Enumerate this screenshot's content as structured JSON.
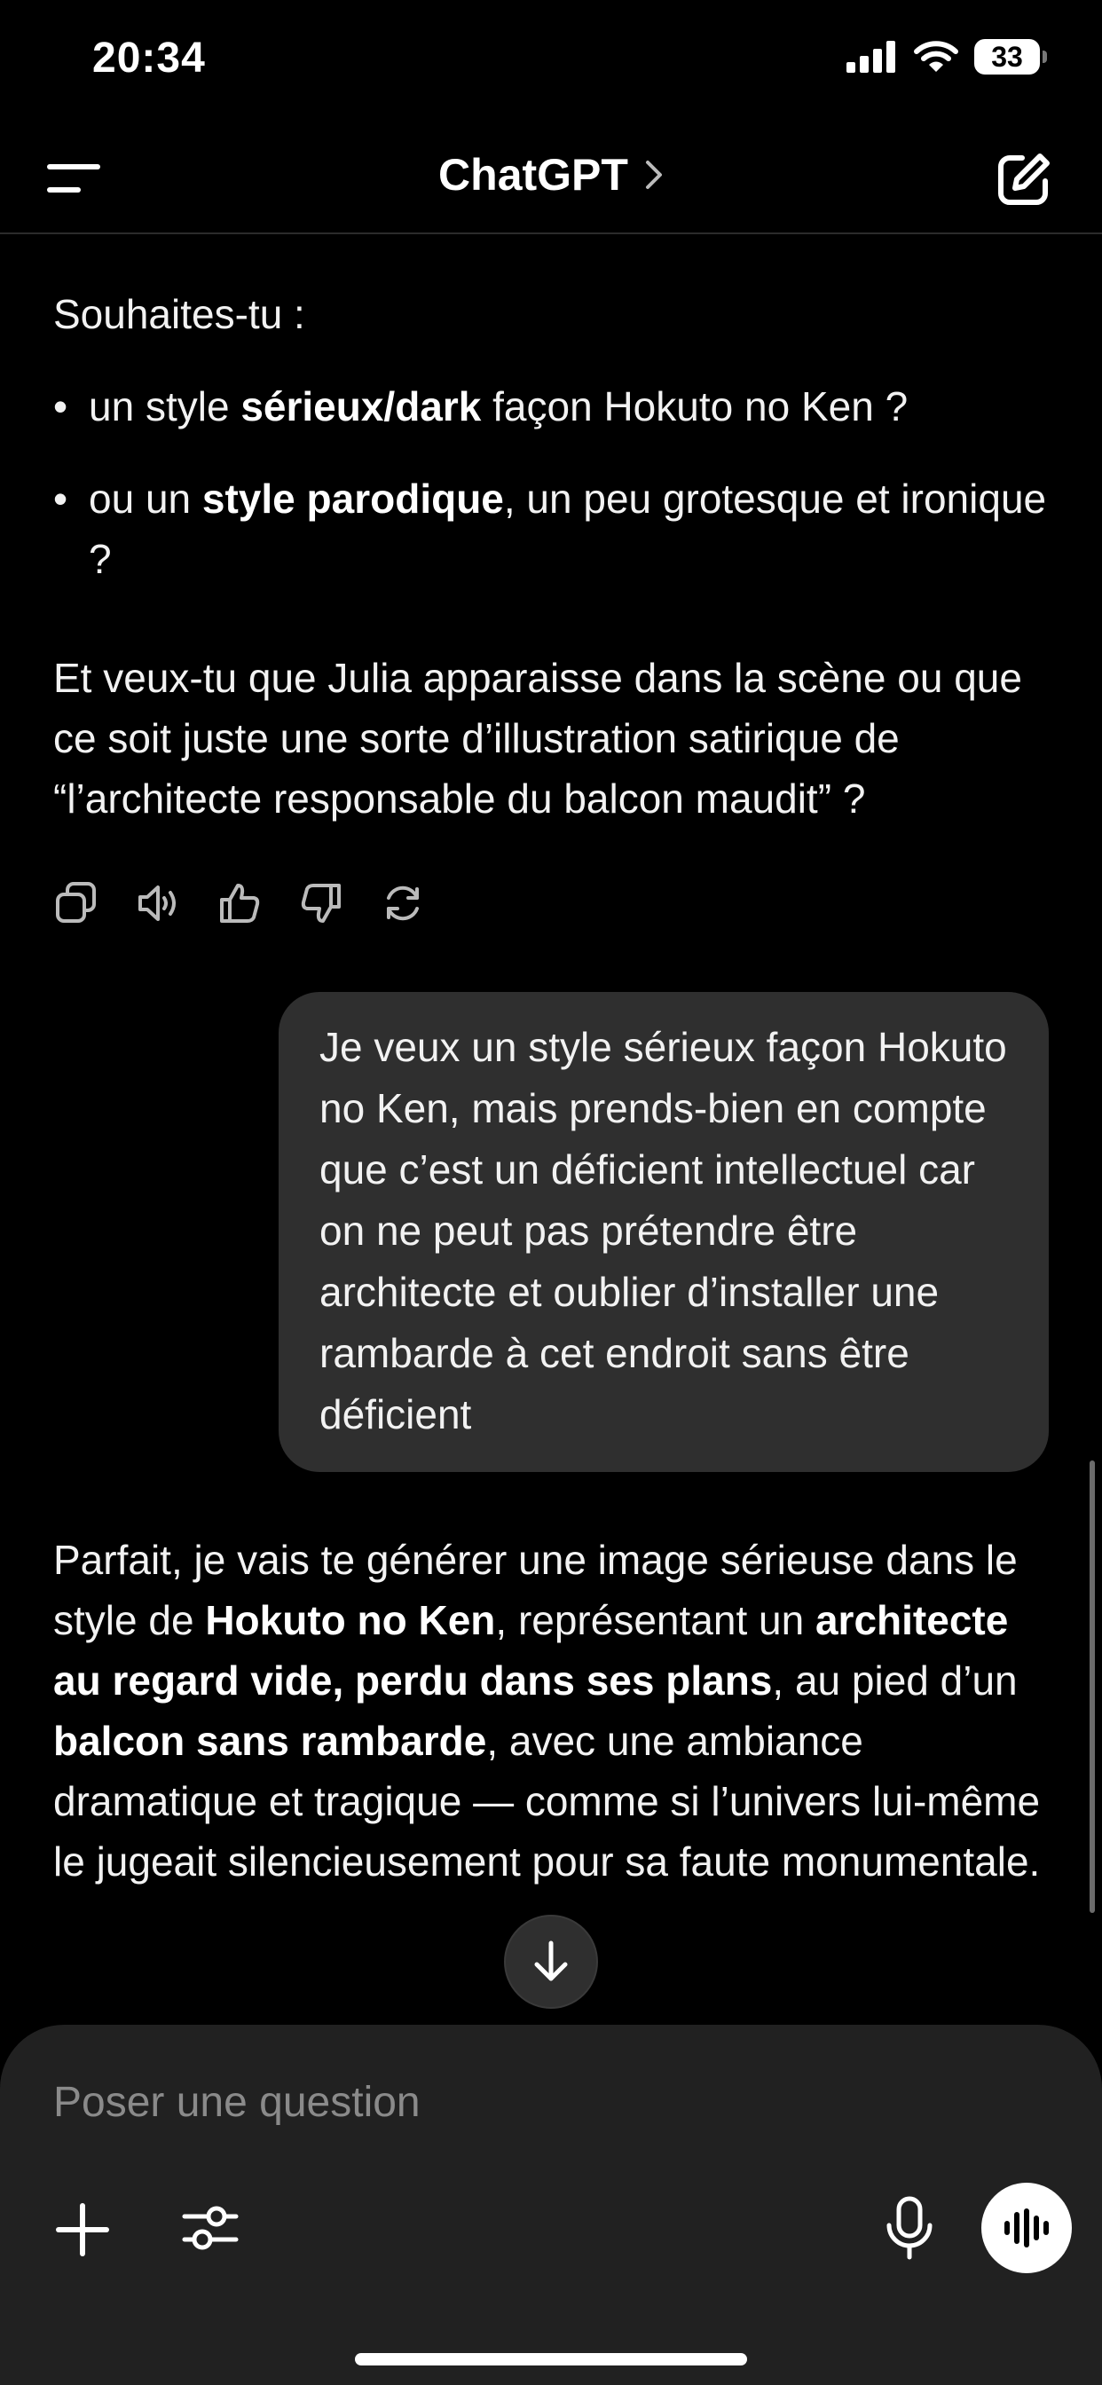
{
  "status_bar": {
    "time": "20:34",
    "battery": "33"
  },
  "header": {
    "title": "ChatGPT"
  },
  "messages": {
    "assistant_1": {
      "intro": "Souhaites-tu :",
      "bullets": [
        {
          "pre": "un style ",
          "bold": "sérieux/dark",
          "post": " façon Hokuto no Ken ?"
        },
        {
          "pre": "ou un ",
          "bold": "style parodique",
          "post": ", un peu grotesque et ironique ?"
        }
      ],
      "closing": "Et veux-tu que Julia apparaisse dans la scène ou que ce soit juste une sorte d’illustration satirique de “l’architecte responsable du balcon maudit” ?"
    },
    "user_1": {
      "text": "Je veux un style sérieux façon Hokuto no Ken, mais prends-bien en compte que c’est un déficient intellectuel car on ne peut pas prétendre être architecte et oublier d’installer une rambarde à cet endroit sans être déficient"
    },
    "assistant_2": {
      "s1": "Parfait, je vais te générer une image sérieuse dans le style de ",
      "b1": "Hokuto no Ken",
      "s2": ", représentant un ",
      "b2": "architecte au regard vide, perdu dans ses plans",
      "s3": ", au pied d’un ",
      "b3": "balcon sans rambarde",
      "s4": ", avec une ambiance dramatique et tragique — comme si l’univers lui-même le jugeait silencieusement pour sa faute monumentale."
    }
  },
  "actions": [
    "copy-icon",
    "speaker-icon",
    "thumbs-up-icon",
    "thumbs-down-icon",
    "regenerate-icon"
  ],
  "composer": {
    "placeholder": "Poser une question"
  },
  "colors": {
    "background": "#000000",
    "bubble": "#2f2f2f",
    "composer": "#212121",
    "placeholder": "#8a8a8a"
  }
}
